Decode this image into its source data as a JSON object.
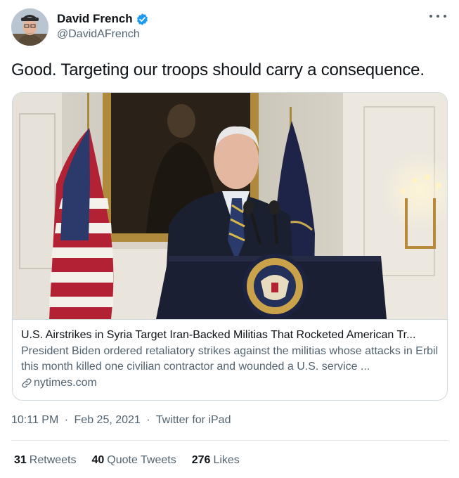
{
  "author": {
    "display_name": "David French",
    "handle": "@DavidAFrench",
    "verified": true
  },
  "tweet": {
    "text": "Good. Targeting our troops should carry a consequence."
  },
  "card": {
    "title": "U.S. Airstrikes in Syria Target Iran-Backed Militias That Rocketed American Tr...",
    "description": "President Biden ordered retaliatory strikes against the militias whose attacks in Erbil this month killed one civilian contractor and wounded a U.S. service ...",
    "domain": "nytimes.com",
    "link_icon": "link-icon"
  },
  "meta": {
    "time": "10:11 PM",
    "date": "Feb 25, 2021",
    "source": "Twitter for iPad",
    "separator": "·"
  },
  "stats": {
    "retweets_count": "31",
    "retweets_label": "Retweets",
    "quotes_count": "40",
    "quotes_label": "Quote Tweets",
    "likes_count": "276",
    "likes_label": "Likes"
  },
  "colors": {
    "verified_blue": "#1d9bf0",
    "secondary_text": "#536471",
    "border": "#cfd9de"
  }
}
